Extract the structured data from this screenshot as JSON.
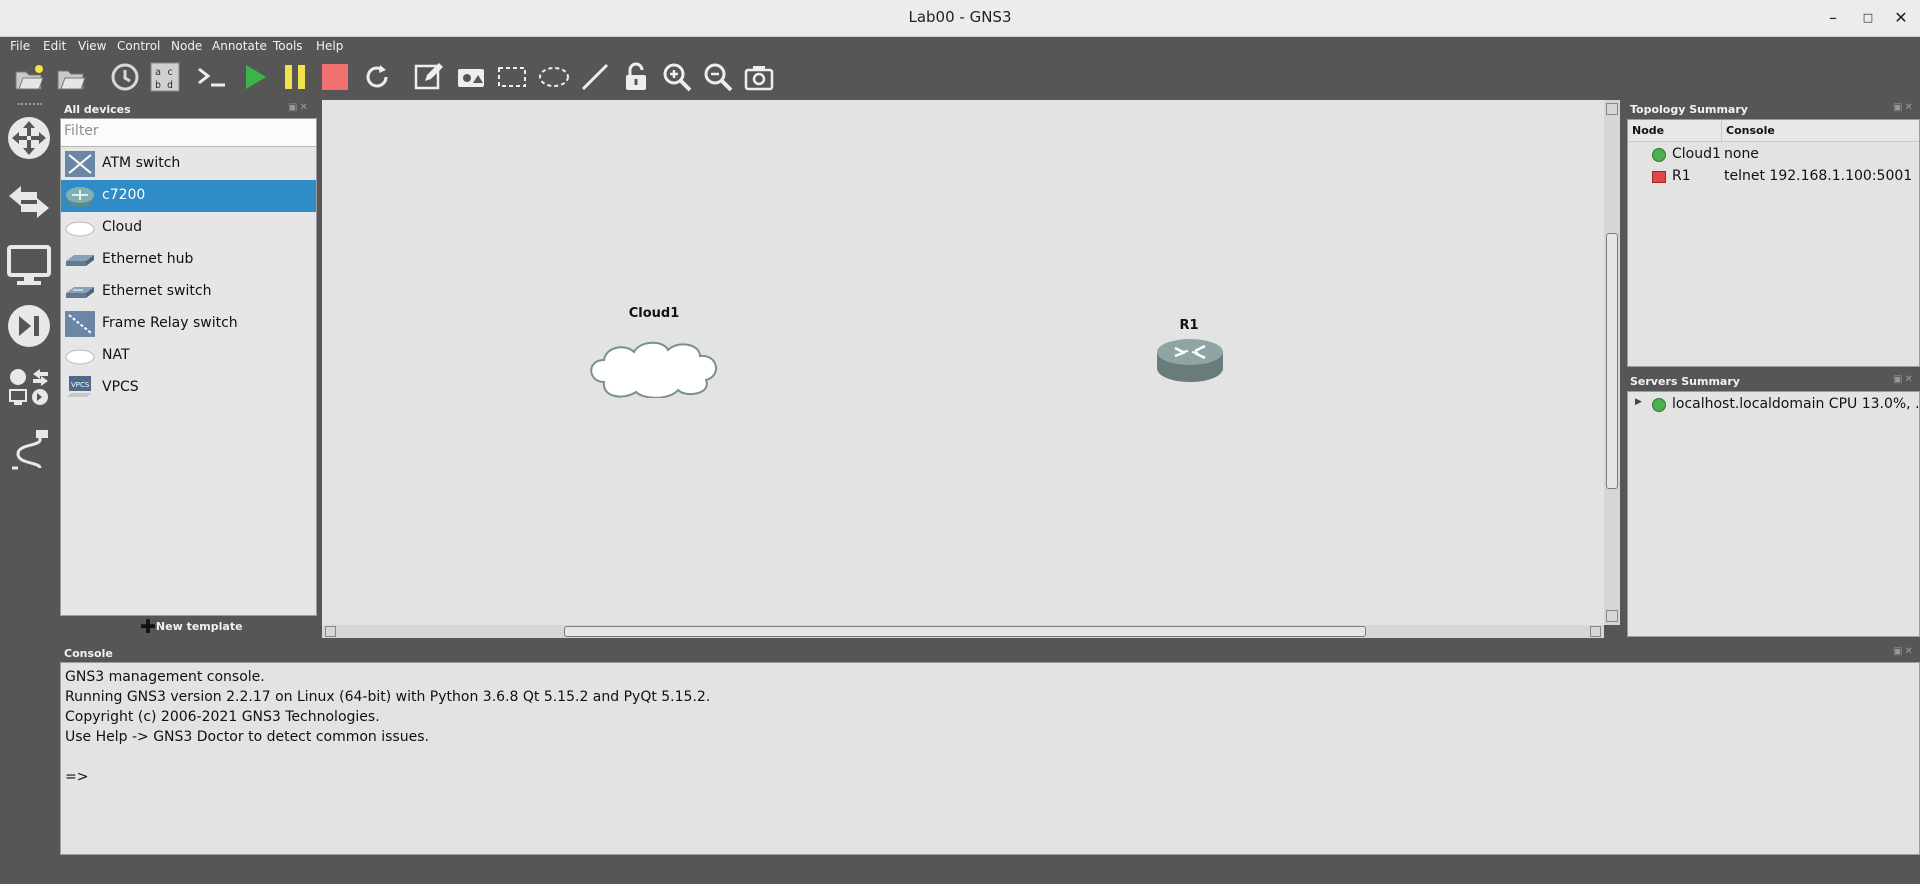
{
  "window": {
    "title": "Lab00 - GNS3"
  },
  "menu": [
    "File",
    "Edit",
    "View",
    "Control",
    "Node",
    "Annotate",
    "Tools",
    "Help"
  ],
  "toolbar_icons": [
    "new-project-icon",
    "open-project-icon",
    "snapshot-icon",
    "show-interface-labels-icon",
    "console-all-icon",
    "start-all-icon",
    "suspend-all-icon",
    "stop-all-icon",
    "reload-all-icon",
    "add-note-icon",
    "insert-image-icon",
    "draw-rectangle-icon",
    "draw-ellipse-icon",
    "draw-line-icon",
    "lock-unlock-icon",
    "zoom-in-icon",
    "zoom-out-icon",
    "screenshot-icon"
  ],
  "left_dock": [
    "browse-routers-icon",
    "browse-switches-icon",
    "browse-end-devices-icon",
    "browse-security-devices-icon",
    "browse-all-devices-icon",
    "add-link-icon"
  ],
  "devices": {
    "title": "All devices",
    "filter_placeholder": "Filter",
    "items": [
      {
        "label": "ATM switch",
        "icon": "atm-switch-icon"
      },
      {
        "label": "c7200",
        "icon": "router-icon",
        "selected": true
      },
      {
        "label": "Cloud",
        "icon": "cloud-icon"
      },
      {
        "label": "Ethernet hub",
        "icon": "ethernet-hub-icon"
      },
      {
        "label": "Ethernet switch",
        "icon": "ethernet-switch-icon"
      },
      {
        "label": "Frame Relay switch",
        "icon": "frame-relay-switch-icon"
      },
      {
        "label": "NAT",
        "icon": "nat-icon"
      },
      {
        "label": "VPCS",
        "icon": "vpcs-icon"
      }
    ],
    "new_template": "New template"
  },
  "canvas": {
    "nodes": [
      {
        "name": "Cloud1",
        "type": "cloud"
      },
      {
        "name": "R1",
        "type": "router"
      }
    ]
  },
  "topology": {
    "title": "Topology Summary",
    "columns": [
      "Node",
      "Console"
    ],
    "rows": [
      {
        "node": "Cloud1",
        "console": "none",
        "status_color": "#4caf50"
      },
      {
        "node": "R1",
        "console": "telnet 192.168.1.100:5001",
        "status_color": "#e04848"
      }
    ]
  },
  "servers": {
    "title": "Servers Summary",
    "items": [
      {
        "label": "localhost.localdomain CPU 13.0%, ...",
        "status_color": "#4caf50"
      }
    ]
  },
  "console": {
    "title": "Console",
    "lines": [
      "GNS3 management console.",
      "Running GNS3 version 2.2.17 on Linux (64-bit) with Python 3.6.8 Qt 5.15.2 and PyQt 5.15.2.",
      "Copyright (c) 2006-2021 GNS3 Technologies.",
      "Use Help -> GNS3 Doctor to detect common issues.",
      "",
      "=>"
    ]
  }
}
